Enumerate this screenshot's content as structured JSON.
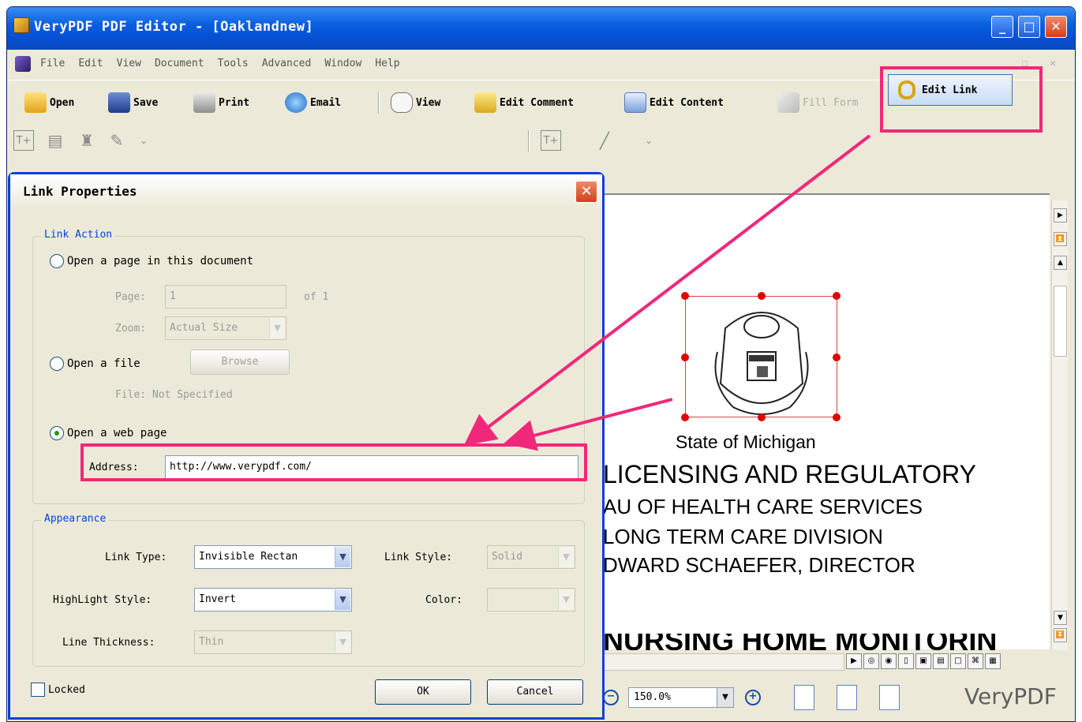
{
  "window": {
    "title": "VeryPDF PDF Editor - [Oaklandnew]",
    "minimize": "_",
    "maximize": "□",
    "close": "✕"
  },
  "menu": {
    "items": [
      "File",
      "Edit",
      "View",
      "Document",
      "Tools",
      "Advanced",
      "Window",
      "Help"
    ],
    "right_controls": "_ ☐ ✕"
  },
  "toolbar": {
    "open": "Open",
    "save": "Save",
    "print": "Print",
    "email": "Email",
    "view": "View",
    "edit_comment": "Edit Comment",
    "edit_content": "Edit Content",
    "fill_form": "Fill Form",
    "edit_link": "Edit Link"
  },
  "status": {
    "zoom": "150.0%"
  },
  "watermark": "VeryPDF",
  "pdf": {
    "line1": "State of Michigan",
    "line2": "LICENSING AND REGULATORY",
    "line3": "AU OF HEALTH CARE SERVICES",
    "line4": "LONG TERM CARE DIVISION",
    "line5": "DWARD SCHAEFER, DIRECTOR",
    "line6": "NURSING HOME MONITORIN"
  },
  "dialog": {
    "title": "Link Properties",
    "link_action": {
      "legend": "Link Action",
      "opt_page": "Open a page in this document",
      "page_label": "Page:",
      "page_value": "1",
      "page_of": "of 1",
      "zoom_label": "Zoom:",
      "zoom_value": "Actual Size",
      "opt_file": "Open a file",
      "browse": "Browse",
      "file_label": "File: Not Specified",
      "opt_web": "Open a web page",
      "address_label": "Address:",
      "address_value": "http://www.verypdf.com/"
    },
    "appearance": {
      "legend": "Appearance",
      "link_type_label": "Link Type:",
      "link_type_value": "Invisible Rectan",
      "link_style_label": "Link Style:",
      "link_style_value": "Solid",
      "highlight_label": "HighLight Style:",
      "highlight_value": "Invert",
      "color_label": "Color:",
      "thickness_label": "Line Thickness:",
      "thickness_value": "Thin"
    },
    "locked": "Locked",
    "ok": "OK",
    "cancel": "Cancel"
  },
  "colors": {
    "highlight": "#f0287a",
    "titlebar": "#0a5fe0"
  }
}
